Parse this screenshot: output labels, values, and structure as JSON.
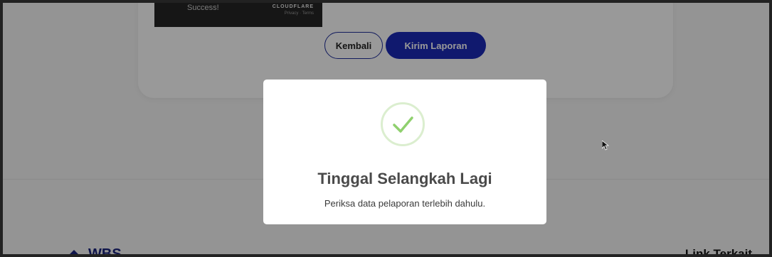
{
  "captcha": {
    "status_text": "Success!",
    "brand": "CLOUDFLARE",
    "legal": "Privacy · Terms"
  },
  "form": {
    "back_label": "Kembali",
    "submit_label": "Kirim Laporan"
  },
  "footer": {
    "logo_text": "WBS",
    "link_heading": "Link Terkait"
  },
  "modal": {
    "icon": "checkmark-icon",
    "title": "Tinggal Selangkah Lagi",
    "message": "Periksa data pelaporan terlebih dahulu."
  },
  "colors": {
    "primary": "#1b2bb8",
    "success_check": "#8fd06e",
    "success_ring": "#dbeecf"
  }
}
